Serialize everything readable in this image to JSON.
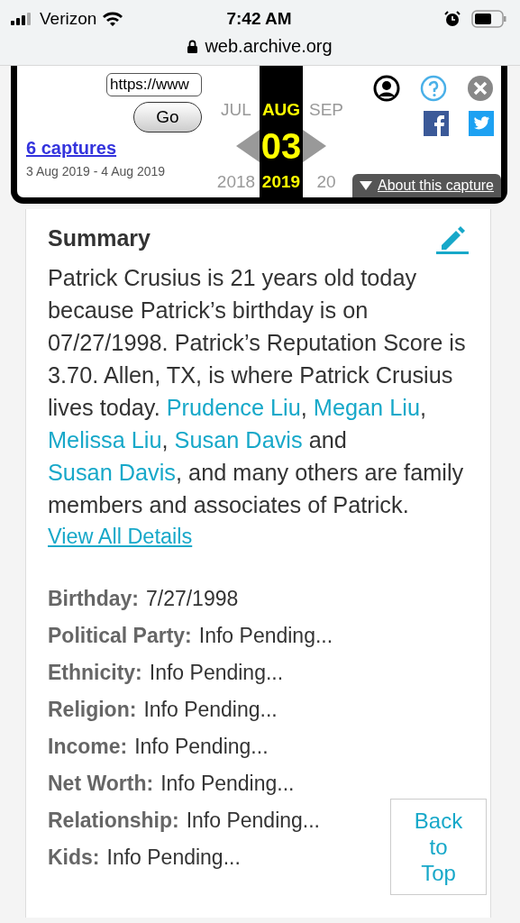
{
  "status_bar": {
    "carrier": "Verizon",
    "time": "7:42 AM"
  },
  "address_bar": {
    "domain": "web.archive.org"
  },
  "wayback": {
    "url_field": {
      "value": "https://www"
    },
    "go_button": "Go",
    "captures_link": "6 captures",
    "date_range": "3 Aug 2019 - 4 Aug 2019",
    "months": [
      {
        "month": "JUL",
        "year": "2018",
        "selected": false
      },
      {
        "month": "AUG",
        "day": "03",
        "year": "2019",
        "selected": true
      },
      {
        "month": "SEP",
        "year": "20",
        "selected": false
      }
    ],
    "about_button": "About this capture"
  },
  "summary": {
    "title": "Summary",
    "paragraph": [
      {
        "kind": "text",
        "text": "Patrick Crusius is 21 years old today because Patrick’s birthday is on 07/27/1998. Patrick’s Reputation Score is 3.70. Allen, TX, is where Patrick Crusius lives today. "
      },
      {
        "kind": "link",
        "text": "Prudence Liu"
      },
      {
        "kind": "text",
        "text": ", "
      },
      {
        "kind": "link",
        "text": "Megan Liu"
      },
      {
        "kind": "text",
        "text": ", "
      },
      {
        "kind": "link",
        "text": "Melissa Liu"
      },
      {
        "kind": "text",
        "text": ", "
      },
      {
        "kind": "link",
        "text": "Susan Davis"
      },
      {
        "kind": "text",
        "text": " and "
      },
      {
        "kind": "link",
        "text": "Susan Davis"
      },
      {
        "kind": "text",
        "text": ", and many others are family members and associates of Patrick."
      }
    ],
    "details_link": "View All Details"
  },
  "details": [
    {
      "label": "Birthday:",
      "value": "7/27/1998"
    },
    {
      "label": "Political Party:",
      "value": "Info Pending..."
    },
    {
      "label": "Ethnicity:",
      "value": "Info Pending..."
    },
    {
      "label": "Religion:",
      "value": "Info Pending..."
    },
    {
      "label": "Income:",
      "value": "Info Pending..."
    },
    {
      "label": "Net Worth:",
      "value": "Info Pending..."
    },
    {
      "label": "Relationship:",
      "value": "Info Pending..."
    },
    {
      "label": "Kids:",
      "value": "Info Pending..."
    }
  ],
  "back_to_top": "Back to Top"
}
